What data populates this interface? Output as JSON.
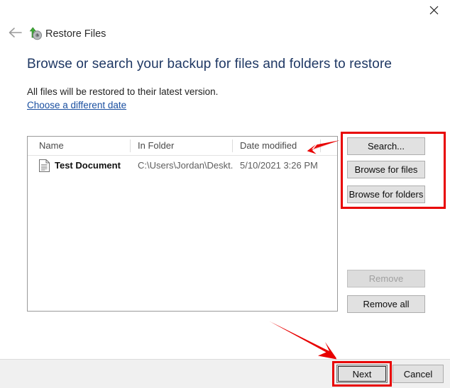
{
  "window": {
    "close_label": "×",
    "close_icon": "close-icon"
  },
  "nav": {
    "back_icon": "back-arrow-icon",
    "app_icon": "restore-files-icon",
    "title": "Restore Files"
  },
  "page": {
    "heading": "Browse or search your backup for files and folders to restore",
    "subtitle": "All files will be restored to their latest version.",
    "link": "Choose a different date"
  },
  "file_list": {
    "columns": [
      "Name",
      "In Folder",
      "Date modified",
      ""
    ],
    "rows": [
      {
        "icon": "document-icon",
        "name": "Test Document",
        "folder": "C:\\Users\\Jordan\\Deskt...",
        "date_modified": "5/10/2021 3:26 PM"
      }
    ]
  },
  "actions": {
    "search": "Search...",
    "browse_files": "Browse for files",
    "browse_folders": "Browse for folders",
    "remove": "Remove",
    "remove_all": "Remove all"
  },
  "footer": {
    "next": "Next",
    "cancel": "Cancel"
  },
  "annotations": {
    "highlight_color": "#e80000",
    "arrow_table_target": "date-modified-column",
    "arrow_next_target": "next-button"
  },
  "colors": {
    "heading": "#1f3864",
    "link": "#1a4fa0",
    "button_face": "#e1e1e1",
    "bottom_bar": "#f0f0f0",
    "annotation_red": "#e80000"
  }
}
